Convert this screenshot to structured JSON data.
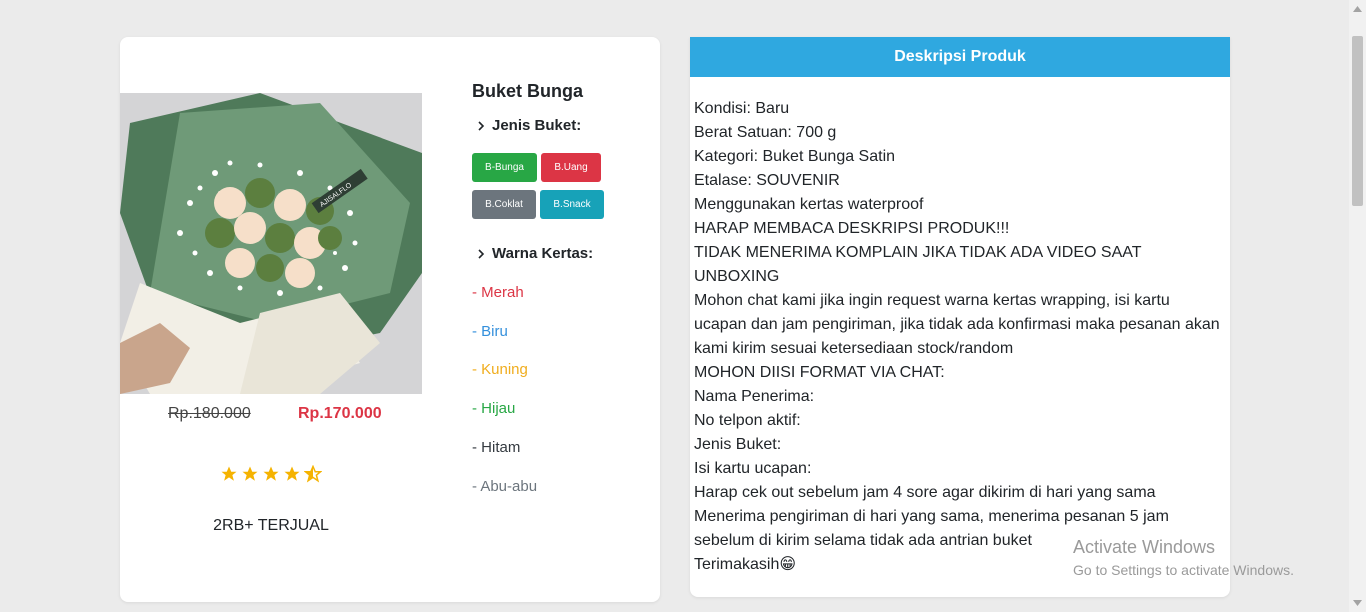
{
  "product": {
    "title": "Buket Bunga",
    "price_old": "Rp.180.000",
    "price_new": "Rp.170.000",
    "rating": 4.5,
    "sold": "2RB+ TERJUAL",
    "image_watermark": "AJISALFLO"
  },
  "jenis": {
    "label": "Jenis Buket:",
    "buttons": [
      {
        "label": "B-Bunga",
        "color": "#28a745"
      },
      {
        "label": "B.Uang",
        "color": "#dc3545"
      },
      {
        "label": "B.Coklat",
        "color": "#6c757d"
      },
      {
        "label": "B.Snack",
        "color": "#17a2b8"
      }
    ]
  },
  "warna": {
    "label": "Warna Kertas:",
    "items": [
      {
        "label": "- Merah",
        "color": "#dc3545"
      },
      {
        "label": "- Biru",
        "color": "#3490dc"
      },
      {
        "label": "- Kuning",
        "color": "#f0ad1e"
      },
      {
        "label": "- Hijau",
        "color": "#28a745"
      },
      {
        "label": "- Hitam",
        "color": "#343a40"
      },
      {
        "label": "- Abu-abu",
        "color": "#6c757d"
      }
    ]
  },
  "description": {
    "header": "Deskripsi Produk",
    "lines": [
      "Kondisi: Baru",
      "Berat Satuan: 700 g",
      "Kategori: Buket Bunga Satin",
      "Etalase: SOUVENIR",
      "Menggunakan kertas waterproof",
      "HARAP MEMBACA DESKRIPSI PRODUK!!!",
      "TIDAK MENERIMA KOMPLAIN JIKA TIDAK ADA VIDEO SAAT",
      "UNBOXING",
      "Mohon chat kami jika ingin request warna kertas wrapping, isi kartu",
      "ucapan dan jam pengiriman, jika tidak ada konfirmasi maka pesanan akan",
      "kami kirim sesuai ketersediaan stock/random",
      "MOHON DIISI FORMAT VIA CHAT:",
      "Nama Penerima:",
      "No telpon aktif:",
      "Jenis Buket:",
      "Isi kartu ucapan:",
      "Harap cek out sebelum jam 4 sore agar dikirim di hari yang sama",
      "Menerima pengiriman di hari yang sama, menerima pesanan 5 jam",
      "sebelum di kirim selama tidak ada antrian buket",
      "Terimakasih😁"
    ]
  },
  "watermark": {
    "line1": "Activate Windows",
    "line2": "Go to Settings to activate Windows."
  },
  "colors": {
    "star": "#f5b301",
    "header_bg": "#2fa8e0"
  }
}
